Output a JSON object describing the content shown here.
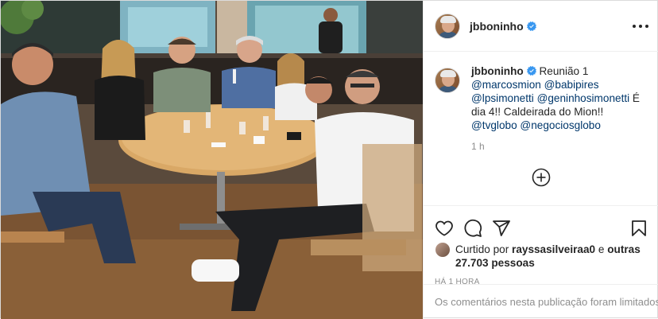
{
  "post": {
    "photo_alt": "",
    "username": "jbboninho",
    "verified": true,
    "more_menu_icon": "more-horizontal-icon",
    "caption": {
      "username": "jbboninho",
      "segments": [
        {
          "type": "text",
          "text": " Reunião 1 "
        },
        {
          "type": "mention",
          "text": "@marcosmion"
        },
        {
          "type": "text",
          "text": " "
        },
        {
          "type": "mention",
          "text": "@babipires"
        },
        {
          "type": "text",
          "text": " "
        },
        {
          "type": "mention",
          "text": "@lpsimonetti"
        },
        {
          "type": "text",
          "text": " "
        },
        {
          "type": "mention",
          "text": "@geninhosimonetti"
        },
        {
          "type": "text",
          "text": " É dia 4!! Caldeirada do Mion!! "
        },
        {
          "type": "mention",
          "text": "@tvglobo"
        },
        {
          "type": "text",
          "text": " "
        },
        {
          "type": "mention",
          "text": "@negociosglobo"
        }
      ],
      "time_ago": "1 h"
    },
    "add_comment_icon": "plus-circle-icon",
    "actions": {
      "like_icon": "heart-icon",
      "comment_icon": "comment-icon",
      "share_icon": "paper-plane-icon",
      "save_icon": "bookmark-icon"
    },
    "likes": {
      "prefix": "Curtido por ",
      "user": "rayssasilveiraa0",
      "middle": " e ",
      "others": "outras 27.703 pessoas"
    },
    "timestamp": "HÁ 1 HORA",
    "comments_limited": "Os comentários nesta publicação foram limitados."
  },
  "colors": {
    "mention": "#00376b",
    "verified": "#3897f0",
    "muted": "#8e8e8e",
    "border": "#efefef"
  }
}
